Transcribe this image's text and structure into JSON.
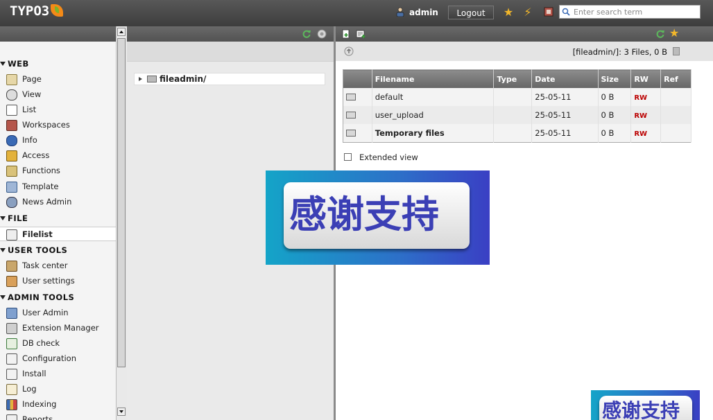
{
  "topbar": {
    "logo_text": "TYPO3",
    "username": "admin",
    "logout_label": "Logout",
    "search_placeholder": "Enter search term"
  },
  "modules": {
    "groups": [
      {
        "label": "WEB",
        "items": [
          "Page",
          "View",
          "List",
          "Workspaces",
          "Info",
          "Access",
          "Functions",
          "Template",
          "News Admin"
        ]
      },
      {
        "label": "FILE",
        "items": [
          "Filelist"
        ]
      },
      {
        "label": "USER TOOLS",
        "items": [
          "Task center",
          "User settings"
        ]
      },
      {
        "label": "ADMIN TOOLS",
        "items": [
          "User Admin",
          "Extension Manager",
          "DB check",
          "Configuration",
          "Install",
          "Log",
          "Indexing",
          "Reports"
        ]
      }
    ],
    "active": "Filelist"
  },
  "tree": {
    "root_label": "fileadmin/"
  },
  "filelist": {
    "path_info": "[fileadmin/]:  3 Files, 0 B",
    "headers": [
      "",
      "Filename",
      "Type",
      "Date",
      "Size",
      "RW",
      "Ref"
    ],
    "rows": [
      {
        "name": "default",
        "type": "",
        "date": "25-05-11",
        "size": "0 B",
        "rw": "RW",
        "ref": "",
        "bold": false
      },
      {
        "name": "user_upload",
        "type": "",
        "date": "25-05-11",
        "size": "0 B",
        "rw": "RW",
        "ref": "",
        "bold": false
      },
      {
        "name": "Temporary files",
        "type": "",
        "date": "25-05-11",
        "size": "0 B",
        "rw": "RW",
        "ref": "",
        "bold": true
      }
    ],
    "extended_view_label": "Extended view"
  },
  "overlay": {
    "banner_text": "感谢支持"
  },
  "colors": {
    "topbar": "#4a4a4a",
    "rw_red": "#bb0000",
    "banner_blue": "#2d6fc8",
    "banner_text": "#3b3fb5"
  }
}
